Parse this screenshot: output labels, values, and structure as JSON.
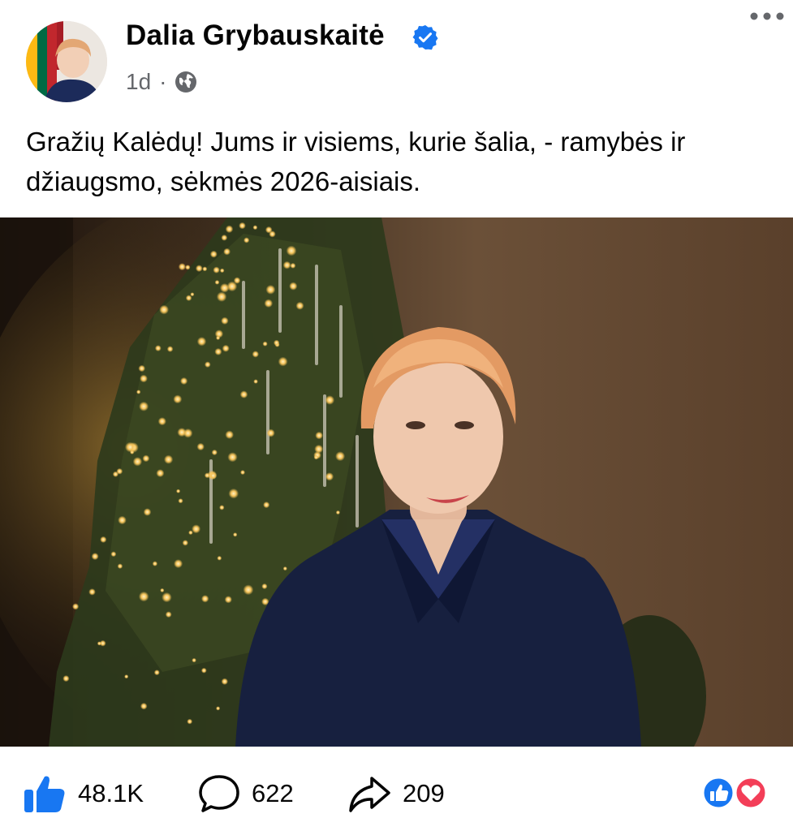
{
  "post": {
    "author": "Dalia Grybauskaitė",
    "time": "1d",
    "separator": "·",
    "caption": "Gražių Kalėdų! Jums ir visiems, kurie šalia, - ramybės ir džiaugsmo, sėkmės 2026-aisiais."
  },
  "engagement": {
    "likes": "48.1K",
    "comments": "622",
    "shares": "209"
  },
  "icons": {
    "verified": "verified-badge-icon",
    "audience": "globe-icon",
    "more": "more-options-icon",
    "like": "thumbs-up-icon",
    "comment": "comment-bubble-icon",
    "share": "share-arrow-icon",
    "reactions": [
      "like-reaction-icon",
      "love-reaction-icon"
    ]
  },
  "colors": {
    "verified": "#1877f2",
    "like": "#1877f2",
    "love": "#f33e58",
    "secondary_text": "#65676b"
  }
}
